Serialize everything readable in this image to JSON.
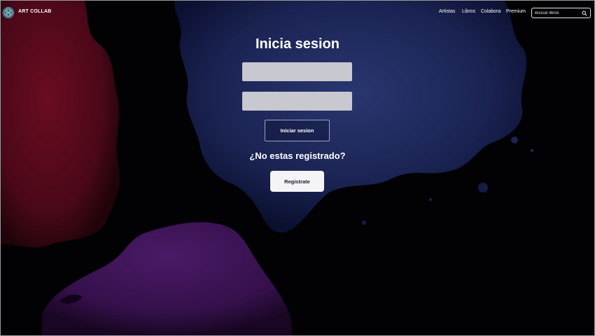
{
  "brand": {
    "name": "ART COLLAB",
    "logo_icon": "globe-logo-icon"
  },
  "nav": {
    "items": [
      {
        "label": "Artistas"
      },
      {
        "label": "Libros"
      },
      {
        "label": "Colabora"
      },
      {
        "label": "Premium"
      }
    ]
  },
  "search": {
    "placeholder": "Buscar libros",
    "icon": "search-icon"
  },
  "login": {
    "title": "Inicia sesion",
    "username_value": "",
    "password_value": "",
    "submit_label": "Iniciar sesion",
    "register_prompt": "¿No estas registrado?",
    "register_label": "Registrate"
  },
  "colors": {
    "background": "#020205",
    "red_splash": "#5a0a1c",
    "blue_splash": "#1e2858",
    "purple_splash": "#3c1250",
    "field_fill": "#c8c8d0",
    "register_button": "#f4f4f7"
  }
}
